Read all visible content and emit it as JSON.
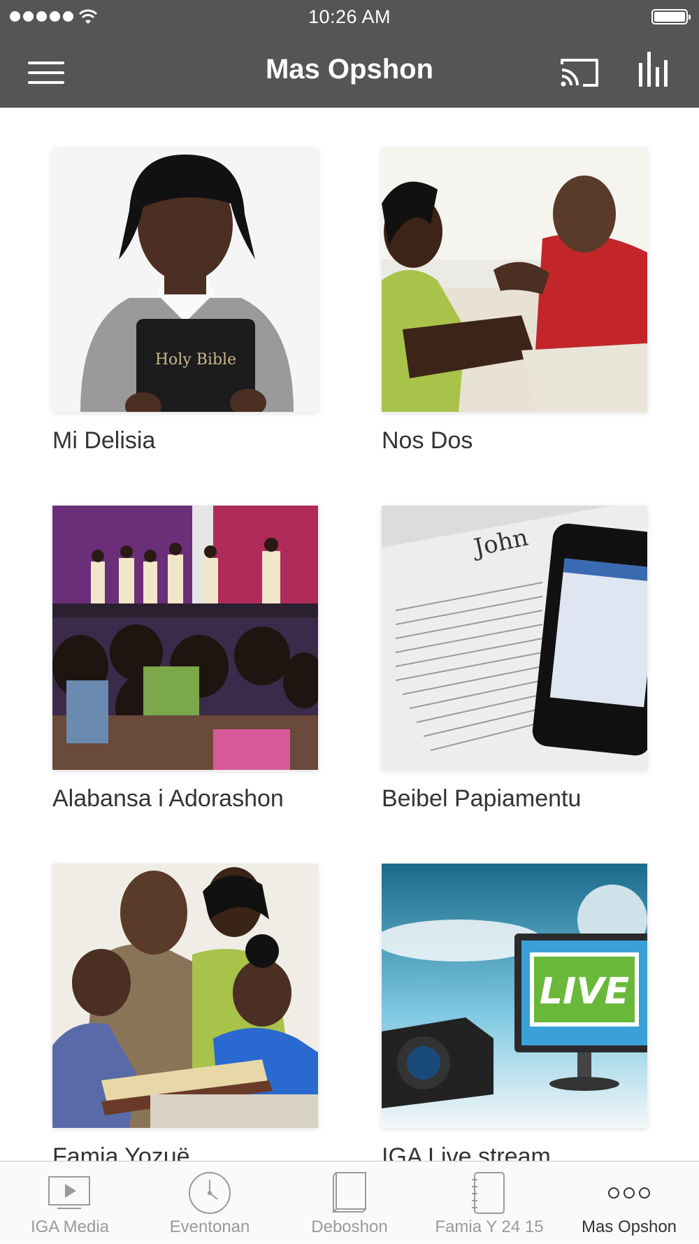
{
  "status_bar": {
    "time": "10:26 AM"
  },
  "nav": {
    "title": "Mas Opshon"
  },
  "tiles": [
    {
      "label": "Mi Delisia"
    },
    {
      "label": "Nos Dos"
    },
    {
      "label": "Alabansa i Adorashon"
    },
    {
      "label": "Beibel Papiamentu"
    },
    {
      "label": "Famia Yozuë"
    },
    {
      "label": "IGA Live stream"
    }
  ],
  "image_text": {
    "bible": "Holy Bible",
    "book": "John",
    "live": "LIVE"
  },
  "tabs": [
    {
      "label": "IGA Media",
      "icon": "video-icon"
    },
    {
      "label": "Eventonan",
      "icon": "clock-icon"
    },
    {
      "label": "Deboshon",
      "icon": "book-icon"
    },
    {
      "label": "Famia Y 24 15",
      "icon": "notebook-icon"
    },
    {
      "label": "Mas Opshon",
      "icon": "more-icon",
      "active": true
    }
  ],
  "colors": {
    "nav_bg": "#555555",
    "tab_active": "#333333",
    "tab_inactive": "#9a9a9a"
  }
}
